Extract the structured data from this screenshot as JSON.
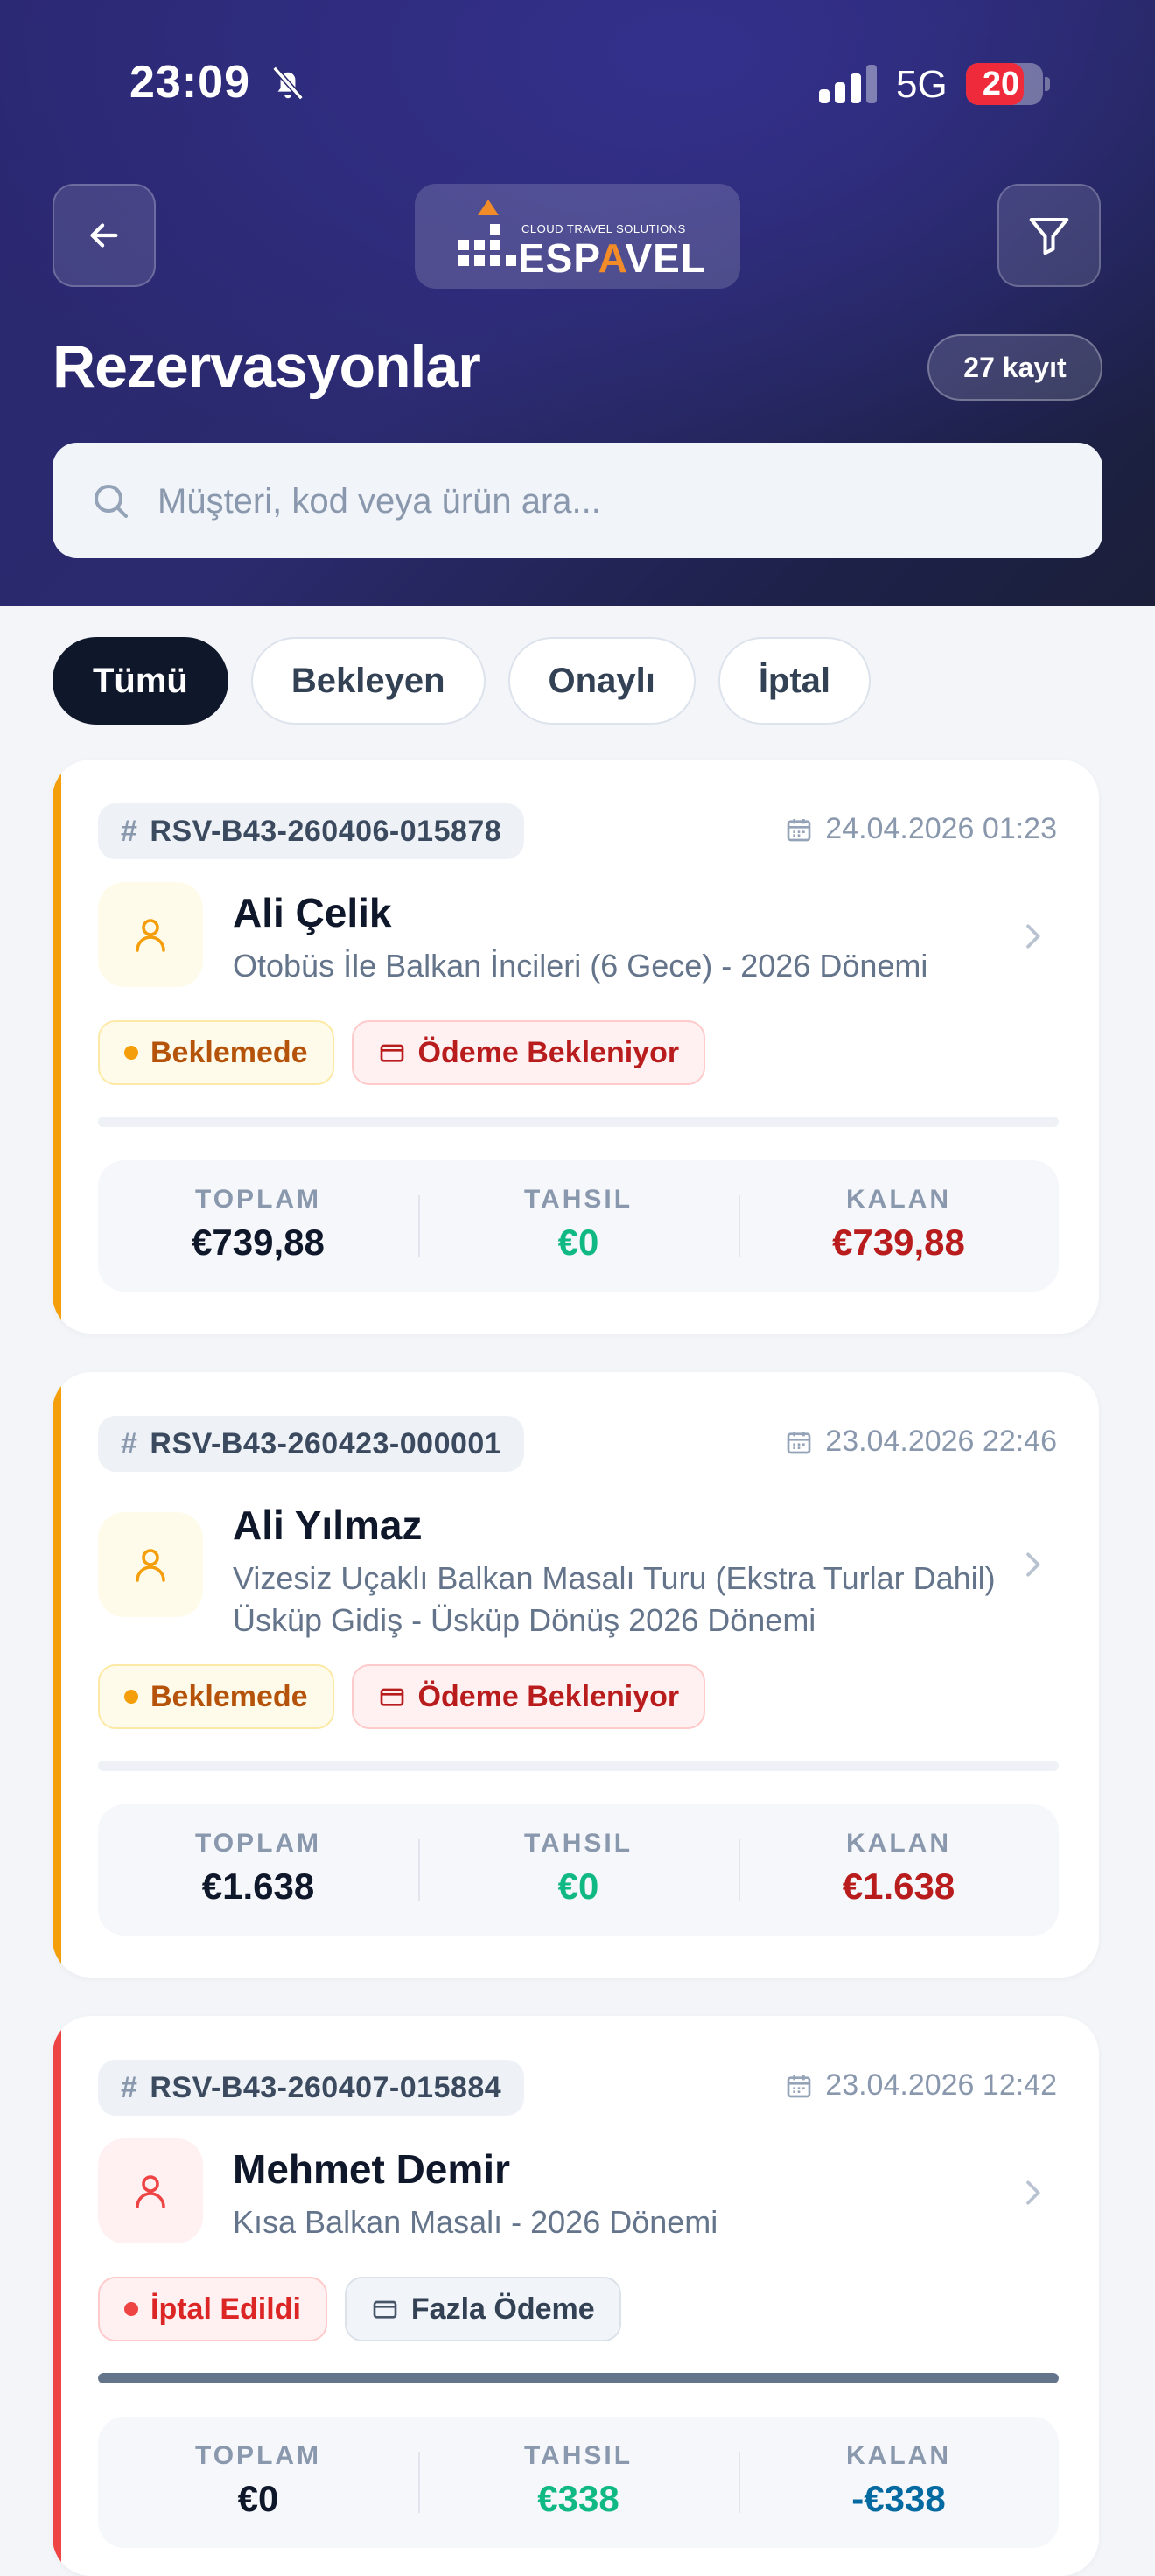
{
  "status_bar": {
    "time": "23:09",
    "network": "5G",
    "battery": "20"
  },
  "header": {
    "logo_tagline": "CLOUD TRAVEL SOLUTIONS",
    "logo_text_pre": "ESP",
    "logo_text_accent": "A",
    "logo_text_post": "VEL",
    "title": "Rezervasyonlar",
    "count": "27 kayıt",
    "search_placeholder": "Müşteri, kod veya ürün ara...",
    "search_value": ""
  },
  "tabs": [
    {
      "label": "Tümü",
      "active": true
    },
    {
      "label": "Bekleyen",
      "active": false
    },
    {
      "label": "Onaylı",
      "active": false
    },
    {
      "label": "İptal",
      "active": false
    }
  ],
  "labels": {
    "total": "TOPLAM",
    "collected": "TAHSIL",
    "remaining": "KALAN"
  },
  "colors": {
    "pending_accent": "#f59e0b",
    "cancel_accent": "#ef4444",
    "header_bg": "#2b2a6e"
  },
  "bookings": [
    {
      "code": "RSV-B43-260406-015878",
      "date": "24.04.2026 01:23",
      "customer": "Ali Çelik",
      "product": "Otobüs İle Balkan İncileri (6 Gece) - 2026 Dönemi",
      "status": "Beklemede",
      "payment_status": "Ödeme Bekleniyor",
      "paid_fraction": 0,
      "total": "€739,88",
      "collected": "€0",
      "remaining": "€739,88"
    },
    {
      "code": "RSV-B43-260423-000001",
      "date": "23.04.2026 22:46",
      "customer": "Ali Yılmaz",
      "product": "Vizesiz Uçaklı Balkan Masalı Turu (Ekstra Turlar Dahil) Üsküp Gidiş - Üsküp Dönüş 2026 Dönemi",
      "status": "Beklemede",
      "payment_status": "Ödeme Bekleniyor",
      "paid_fraction": 0,
      "total": "€1.638",
      "collected": "€0",
      "remaining": "€1.638"
    },
    {
      "code": "RSV-B43-260407-015884",
      "date": "23.04.2026 12:42",
      "customer": "Mehmet Demir",
      "product": "Kısa Balkan Masalı - 2026 Dönemi",
      "status": "İptal Edildi",
      "payment_status": "Fazla Ödeme",
      "paid_fraction": 1,
      "total": "€0",
      "collected": "€338",
      "remaining": "-€338"
    }
  ]
}
